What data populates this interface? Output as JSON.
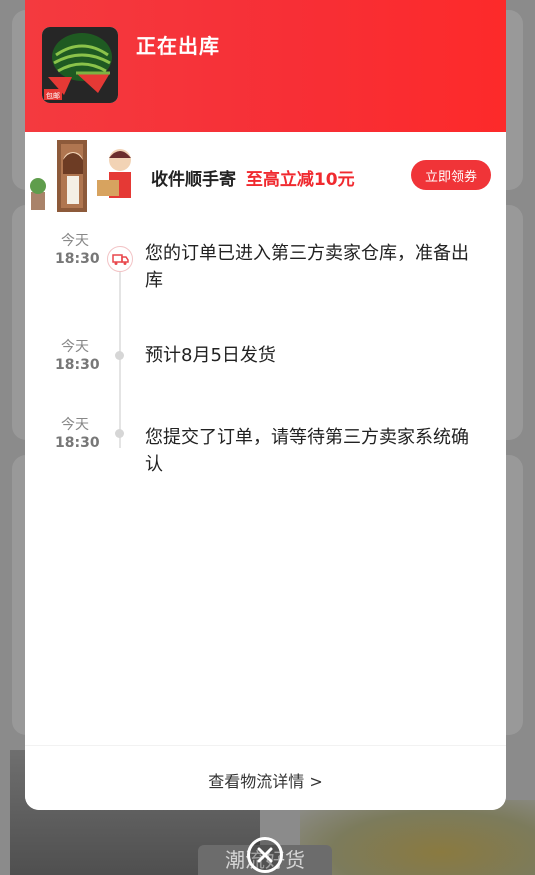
{
  "header": {
    "status_title": "正在出库",
    "product_badge": "包邮"
  },
  "promo": {
    "label": "收件顺手寄",
    "highlight": "至高立减10元",
    "claim_button": "立即领券"
  },
  "timeline": [
    {
      "day": "今天",
      "time": "18:30",
      "text": "您的订单已进入第三方卖家仓库，准备出库",
      "icon": "truck-icon"
    },
    {
      "day": "今天",
      "time": "18:30",
      "text": "预计8月5日发货",
      "icon": "dot"
    },
    {
      "day": "今天",
      "time": "18:30",
      "text": "您提交了订单，请等待第三方卖家系统确认",
      "icon": "dot"
    }
  ],
  "footer": {
    "logistics_link": "查看物流详情 >"
  },
  "background": {
    "tag_text": "潮流好货"
  },
  "colors": {
    "brand_red": "#f43a3f",
    "button_red": "#f03438",
    "text_dark": "#222222",
    "text_muted": "#888888"
  }
}
